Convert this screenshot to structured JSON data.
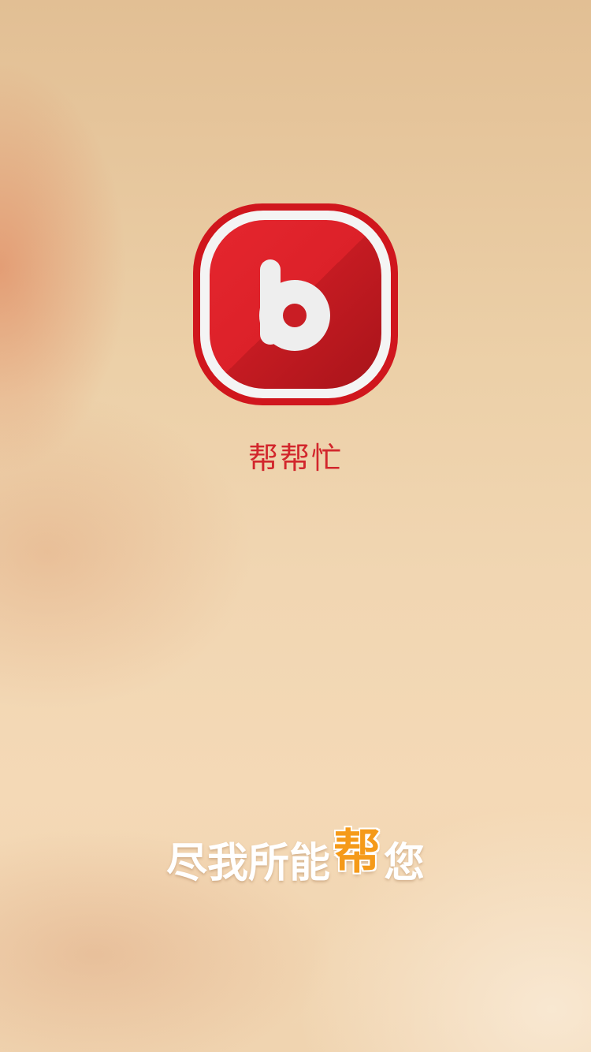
{
  "splash": {
    "app_name": "帮帮忙",
    "slogan_before": "尽我所能",
    "slogan_highlight": "帮",
    "slogan_after": "您",
    "logo": {
      "icon": "letter-b-logo-icon",
      "glyph": "b"
    }
  },
  "colors": {
    "brand_red": "#d2262c",
    "highlight_orange": "#f59a19",
    "slogan_white": "#ffffff"
  }
}
